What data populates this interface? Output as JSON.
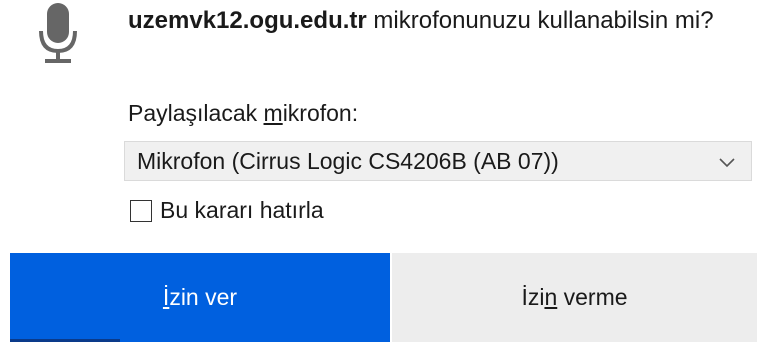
{
  "prompt": {
    "host": "uzemvk12.ogu.edu.tr",
    "message": " mikrofonunuzu kullanabilsin mi?"
  },
  "share": {
    "label_before": "Paylaşılacak ",
    "label_accesskey": "m",
    "label_after": "ikrofon:"
  },
  "device_select": {
    "selected": "Mikrofon (Cirrus Logic CS4206B (AB 07))"
  },
  "remember": {
    "label": "Bu kararı hatırla",
    "checked": false
  },
  "buttons": {
    "allow_before": "",
    "allow_key": "İ",
    "allow_after": "zin ver",
    "deny_before": "İzi",
    "deny_key": "n",
    "deny_after": " verme"
  },
  "colors": {
    "primary": "#0060df",
    "secondary": "#ededed",
    "select_bg": "#f0f0f0"
  },
  "icons": {
    "prompt": "microphone-icon",
    "select": "chevron-down-icon"
  }
}
